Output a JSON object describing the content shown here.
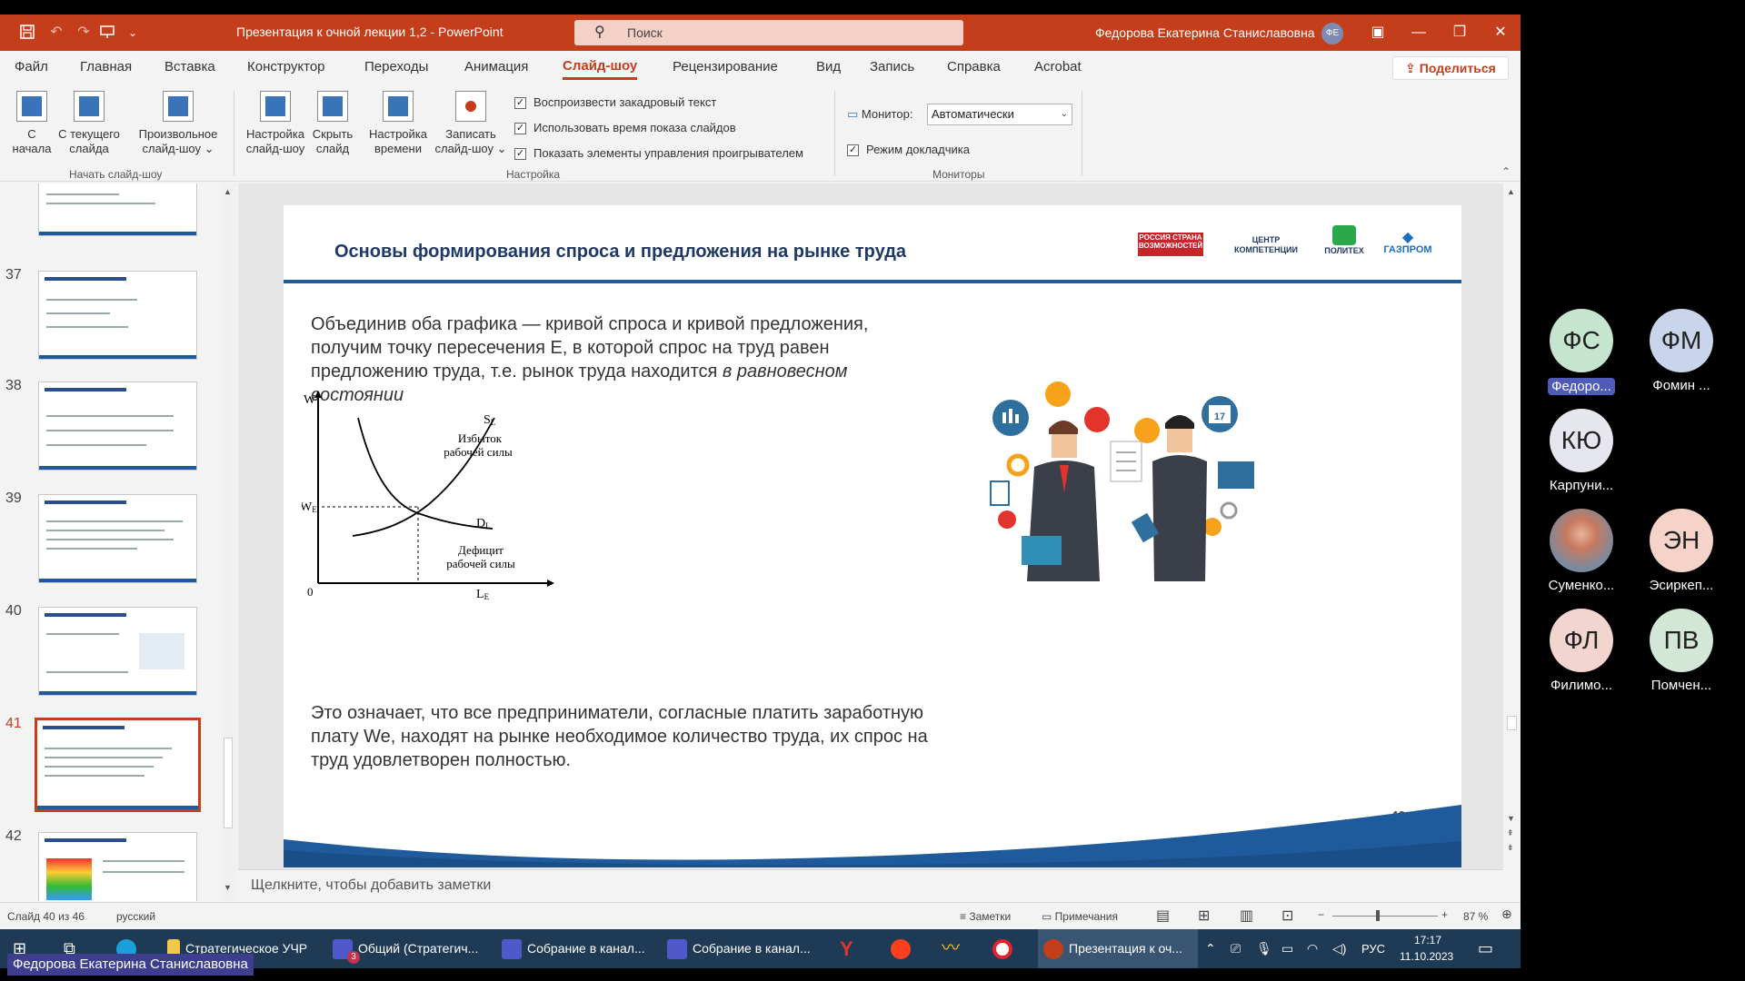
{
  "window": {
    "doc_title": "Презентация к очной лекции 1,2  -  PowerPoint",
    "search_placeholder": "Поиск",
    "user_name": "Федорова Екатерина Станиславовна",
    "user_initials": "ФЕ"
  },
  "tabs": [
    "Файл",
    "Главная",
    "Вставка",
    "Конструктор",
    "Переходы",
    "Анимация",
    "Слайд-шоу",
    "Рецензирование",
    "Вид",
    "Запись",
    "Справка",
    "Acrobat"
  ],
  "share_label": "Поделиться",
  "ribbon": {
    "b1_l1": "С",
    "b1_l2": "начала",
    "b2_l1": "С текущего",
    "b2_l2": "слайда",
    "b3_l1": "Произвольное",
    "b3_l2": "слайд-шоу ⌄",
    "group1": "Начать слайд-шоу",
    "b4_l1": "Настройка",
    "b4_l2": "слайд-шоу",
    "b5_l1": "Скрыть",
    "b5_l2": "слайд",
    "b6_l1": "Настройка",
    "b6_l2": "времени",
    "b7_l1": "Записать",
    "b7_l2": "слайд-шоу ⌄",
    "chk1": "Воспроизвести закадровый текст",
    "chk2": "Использовать время показа слайдов",
    "chk3": "Показать элементы управления проигрывателем",
    "group2": "Настройка",
    "monitor_label": "Монитор:",
    "monitor_value": "Автоматически",
    "chk4": "Режим докладчика",
    "group3": "Мониторы"
  },
  "thumbs": [
    "37",
    "38",
    "39",
    "40",
    "41",
    "42"
  ],
  "slide": {
    "title": "Основы формирования спроса и предложения на рынке труда",
    "logo1": "РОССИЯ СТРАНА ВОЗМОЖНОСТЕЙ",
    "logo2": "ЦЕНТР КОМПЕТЕНЦИИ",
    "logo3": "ПОЛИТЕХ",
    "logo4": "ГАЗПРОМ",
    "p1": "Объединив оба графика — кривой спроса и кривой предложения, получим точку пересечения Е, в которой спрос на труд равен предложению труда, т.е. рынок труда находится ",
    "p1_em": "в равновесном состоянии",
    "p2": "Это означает, что все предприниматели, согласные платить заработную плату We, находят на рынке необходимое количество труда, их спрос на труд удовлетворен полностью.",
    "graph": {
      "w": "W",
      "we": "W",
      "we_sub": "E",
      "zero": "0",
      "sl": "S",
      "sl_sub": "L",
      "dl": "D",
      "dl_sub": "L",
      "le": "L",
      "le_sub": "E",
      "surplus1": "Избыток",
      "surplus2": "рабочей силы",
      "deficit1": "Дефицит",
      "deficit2": "рабочей силы"
    },
    "calendar": "17",
    "number": "40"
  },
  "notes_placeholder": "Щелкните, чтобы добавить заметки",
  "status": {
    "slide": "Слайд 40 из 46",
    "lang": "русский",
    "notes": "Заметки",
    "comments": "Примечания",
    "zoom": "87 %"
  },
  "taskbar": {
    "t1": "Стратегическое УЧР",
    "t2": "Общий (Стратегич...",
    "t3": "Собрание в канал...",
    "t4": "Собрание в канал...",
    "t5": "Презентация к оч...",
    "lang": "РУС",
    "time": "17:17",
    "date": "11.10.2023",
    "badge": "3"
  },
  "caption": "Федорова Екатерина Станиславовна",
  "participants": [
    {
      "initials": "ФС",
      "name": "Федоро..."
    },
    {
      "initials": "ФМ",
      "name": "Фомин ..."
    },
    {
      "initials": "КЮ",
      "name": "Карпуни..."
    },
    {
      "initials": "",
      "name": "Суменко..."
    },
    {
      "initials": "ЭН",
      "name": "Эсиркеп..."
    },
    {
      "initials": "ФЛ",
      "name": "Филимо..."
    },
    {
      "initials": "ПВ",
      "name": "Помчен..."
    }
  ],
  "colors": {
    "accent": "#c43e1c",
    "slide_blue": "#1f5b9c",
    "title_blue": "#1f3864"
  }
}
